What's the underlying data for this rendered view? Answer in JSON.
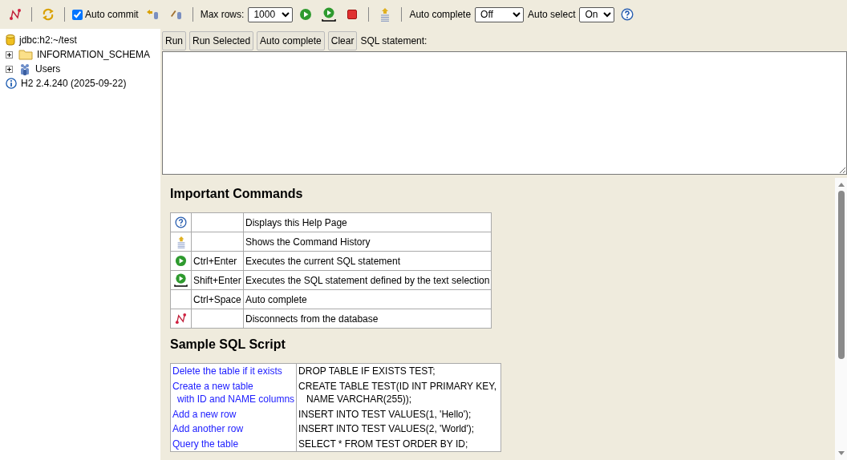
{
  "toolbar": {
    "auto_commit": {
      "label": "Auto commit",
      "checked": true
    },
    "max_rows": {
      "label": "Max rows:",
      "value": "1000"
    },
    "auto_complete": {
      "label": "Auto complete",
      "value": "Off"
    },
    "auto_select": {
      "label": "Auto select",
      "value": "On"
    }
  },
  "tree": [
    {
      "kind": "database",
      "label": "jdbc:h2:~/test"
    },
    {
      "kind": "folder",
      "label": "INFORMATION_SCHEMA",
      "expanded": false
    },
    {
      "kind": "users",
      "label": "Users",
      "expanded": false
    },
    {
      "kind": "info",
      "label": "H2 2.4.240 (2025-09-22)"
    }
  ],
  "buttons": [
    "Run",
    "Run Selected",
    "Auto complete",
    "Clear"
  ],
  "sql_label": "SQL statement:",
  "help": {
    "commands_title": "Important Commands",
    "commands": [
      {
        "kind": "help",
        "description": "Displays this Help Page"
      },
      {
        "kind": "history",
        "description": "Shows the Command History"
      },
      {
        "kind": "run",
        "shortcut": "Ctrl+Enter",
        "description": "Executes the current SQL statement"
      },
      {
        "kind": "runselected",
        "shortcut": "Shift+Enter",
        "description": "Executes the SQL statement defined by the text selection"
      },
      {
        "kind": "plain",
        "shortcut": "Ctrl+Space",
        "description": "Auto complete"
      },
      {
        "kind": "disconnect",
        "description": "Disconnects from the database"
      }
    ],
    "sample_title": "Sample SQL Script",
    "sample": [
      {
        "step": [
          "Delete the table if it exists"
        ],
        "sql": [
          "DROP TABLE IF EXISTS TEST;"
        ]
      },
      {
        "step": [
          "Create a new table",
          "with ID and NAME columns"
        ],
        "sql": [
          "CREATE TABLE TEST(ID INT PRIMARY KEY,",
          "NAME VARCHAR(255));"
        ]
      },
      {
        "step": [
          "Add a new row"
        ],
        "sql": [
          "INSERT INTO TEST VALUES(1, 'Hello');"
        ]
      },
      {
        "step": [
          "Add another row"
        ],
        "sql": [
          "INSERT INTO TEST VALUES(2, 'World');"
        ]
      },
      {
        "step": [
          "Query the table"
        ],
        "sql": [
          "SELECT * FROM TEST ORDER BY ID;"
        ]
      }
    ]
  }
}
